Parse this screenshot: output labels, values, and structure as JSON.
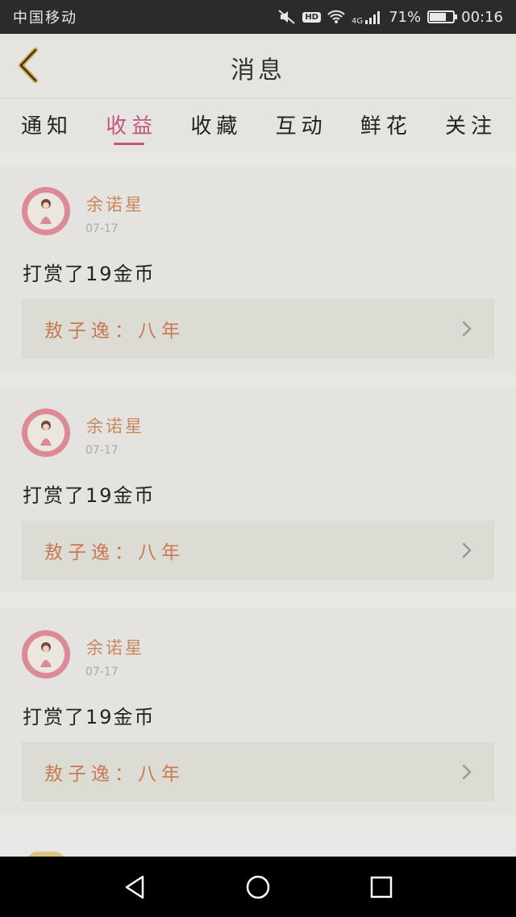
{
  "status_bar": {
    "carrier": "中国移动",
    "network": "4G",
    "hd": "HD",
    "battery": "71%",
    "battery_level": 0.71,
    "time": "00:16",
    "icons": [
      "mute-icon",
      "wifi-icon",
      "signal-icon",
      "battery-icon"
    ]
  },
  "header": {
    "title": "消息",
    "back_icon": "chevron-left-icon"
  },
  "tabs": [
    {
      "label": "通知",
      "active": false
    },
    {
      "label": "收益",
      "active": true
    },
    {
      "label": "收藏",
      "active": false
    },
    {
      "label": "互动",
      "active": false
    },
    {
      "label": "鲜花",
      "active": false
    },
    {
      "label": "关注",
      "active": false
    }
  ],
  "messages": [
    {
      "username": "余诺星",
      "date": "07-17",
      "text": "打赏了19金币",
      "reference": "敖子逸：八年"
    },
    {
      "username": "余诺星",
      "date": "07-17",
      "text": "打赏了19金币",
      "reference": "敖子逸：八年"
    },
    {
      "username": "余诺星",
      "date": "07-17",
      "text": "打赏了19金币",
      "reference": "敖子逸：八年"
    }
  ],
  "colors": {
    "accent": "#c1567e",
    "username": "#c8885c",
    "reference": "#c77a52"
  },
  "nav": [
    "back-triangle-icon",
    "home-circle-icon",
    "recents-square-icon"
  ]
}
